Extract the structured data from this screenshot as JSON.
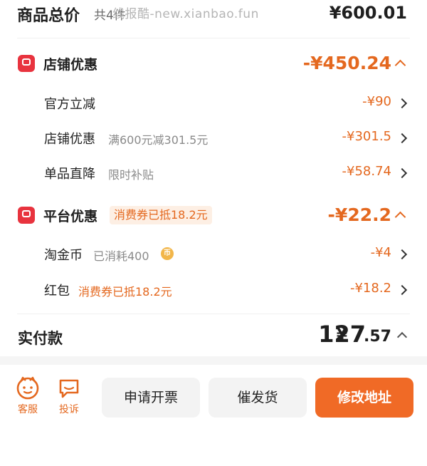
{
  "header": {
    "total_label": "商品总价",
    "item_count": "共4件",
    "watermark": "线报酷-new.xianbao.fun",
    "total_amount": "¥600.01"
  },
  "shop_discount": {
    "title": "店铺优惠",
    "amount": "-¥450.24",
    "items": [
      {
        "label": "官方立减",
        "sub": "",
        "amount": "-¥90"
      },
      {
        "label": "店铺优惠",
        "sub": "满600元减301.5元",
        "amount": "-¥301.5"
      },
      {
        "label": "单品直降",
        "sub": "限时补贴",
        "amount": "-¥58.74"
      }
    ]
  },
  "platform_discount": {
    "title": "平台优惠",
    "tag": "消费券已抵18.2元",
    "amount": "-¥22.2",
    "items": [
      {
        "label": "淘金币",
        "sub": "已消耗400",
        "coin": "币",
        "amount": "-¥4"
      },
      {
        "label": "红包",
        "sub": "消费券已抵18.2元",
        "amount": "-¥18.2"
      }
    ]
  },
  "payment": {
    "label": "实付款",
    "symbol": "¥",
    "integer": "127",
    "decimal": ".57"
  },
  "bottom_bar": {
    "service_label": "客服",
    "complaint_label": "投诉",
    "invoice_button": "申请开票",
    "rush_button": "催发货",
    "address_button": "修改地址"
  },
  "colors": {
    "accent": "#e4681f",
    "badge": "#e8333e",
    "primary_button": "#f06a26"
  }
}
